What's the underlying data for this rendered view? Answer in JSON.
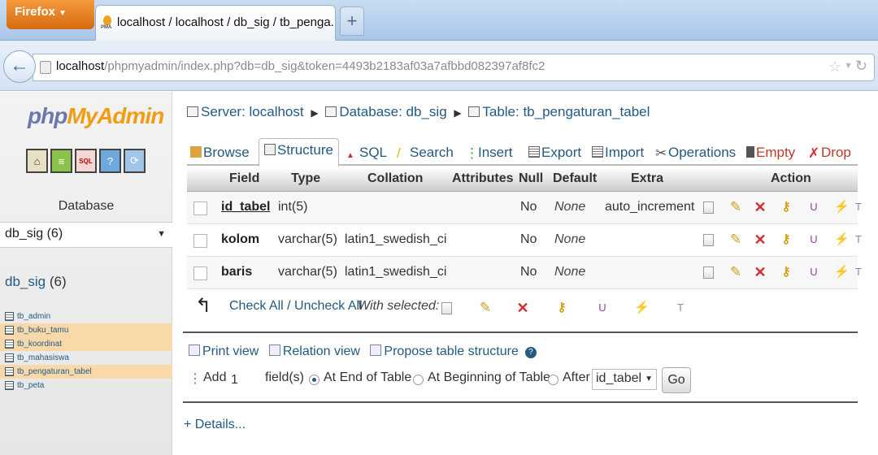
{
  "browser": {
    "app_button": "Firefox",
    "tab_title": "localhost / localhost / db_sig / tb_penga...",
    "new_tab": "+",
    "url_host": "localhost",
    "url_path": "/phpmyadmin/index.php?db=db_sig&token=4493b2183af03a7afbbd082397af8fc2"
  },
  "sidebar": {
    "logo_php": "php",
    "logo_myadmin": "MyAdmin",
    "database_label": "Database",
    "selected_db": "db_sig (6)",
    "db_heading": "db_sig",
    "db_count": "(6)",
    "tables": [
      {
        "name": "tb_admin"
      },
      {
        "name": "tb_buku_tamu"
      },
      {
        "name": "tb_koordinat"
      },
      {
        "name": "tb_mahasiswa"
      },
      {
        "name": "tb_pengaturan_tabel"
      },
      {
        "name": "tb_peta"
      }
    ]
  },
  "breadcrumb": {
    "server": "Server: localhost",
    "database": "Database: db_sig",
    "table": "Table: tb_pengaturan_tabel"
  },
  "tabs": {
    "browse": "Browse",
    "structure": "Structure",
    "sql": "SQL",
    "search": "Search",
    "insert": "Insert",
    "export": "Export",
    "import": "Import",
    "operations": "Operations",
    "empty": "Empty",
    "drop": "Drop"
  },
  "table_headers": {
    "field": "Field",
    "type": "Type",
    "collation": "Collation",
    "attributes": "Attributes",
    "null": "Null",
    "default": "Default",
    "extra": "Extra",
    "action": "Action"
  },
  "rows": [
    {
      "field": "id_tabel",
      "type": "int(5)",
      "collation": "",
      "attributes": "",
      "null": "No",
      "default": "None",
      "extra": "auto_increment"
    },
    {
      "field": "kolom",
      "type": "varchar(5)",
      "collation": "latin1_swedish_ci",
      "attributes": "",
      "null": "No",
      "default": "None",
      "extra": ""
    },
    {
      "field": "baris",
      "type": "varchar(5)",
      "collation": "latin1_swedish_ci",
      "attributes": "",
      "null": "No",
      "default": "None",
      "extra": ""
    }
  ],
  "bulk": {
    "check_all": "Check All / Uncheck All",
    "with_selected": "With selected:"
  },
  "links": {
    "print_view": "Print view",
    "relation_view": "Relation view",
    "propose": "Propose table structure"
  },
  "add_fields": {
    "add_label": "Add",
    "count": "1",
    "fields_label": "field(s)",
    "at_end": "At End of Table",
    "at_beginning": "At Beginning of Table",
    "after": "After",
    "after_field": "id_tabel",
    "go": "Go"
  },
  "details": "+ Details..."
}
